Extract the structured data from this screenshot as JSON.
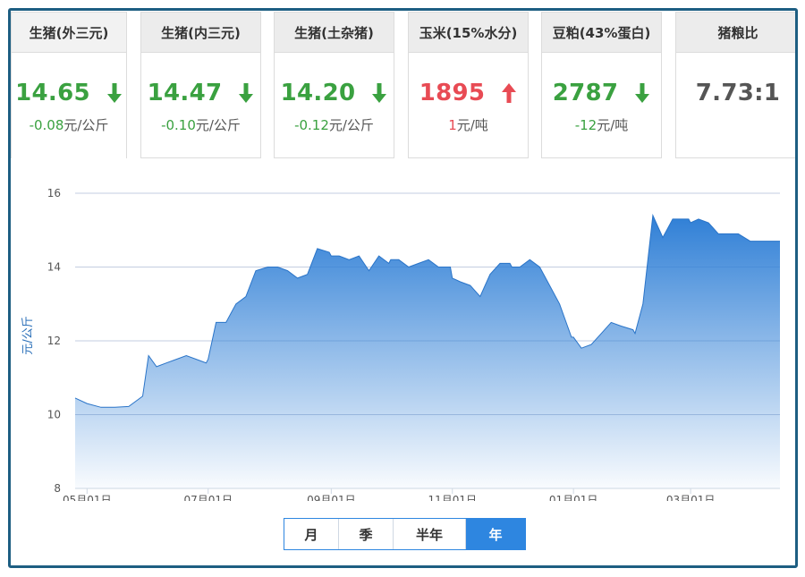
{
  "cards": [
    {
      "title": "生猪(外三元)",
      "price": "14.65",
      "change_num": "-0.08",
      "change_unit": "元/公斤",
      "direction": "down"
    },
    {
      "title": "生猪(内三元)",
      "price": "14.47",
      "change_num": "-0.10",
      "change_unit": "元/公斤",
      "direction": "down"
    },
    {
      "title": "生猪(土杂猪)",
      "price": "14.20",
      "change_num": "-0.12",
      "change_unit": "元/公斤",
      "direction": "down"
    },
    {
      "title": "玉米(15%水分)",
      "price": "1895",
      "change_num": "1",
      "change_unit": "元/吨",
      "direction": "up"
    },
    {
      "title": "豆粕(43%蛋白)",
      "price": "2787",
      "change_num": "-12",
      "change_unit": "元/吨",
      "direction": "down"
    },
    {
      "title": "猪粮比",
      "price": "7.73:1",
      "change_num": "",
      "change_unit": "",
      "direction": "none"
    }
  ],
  "colors": {
    "up": "#e84b54",
    "down": "#3aa140",
    "accent": "#2e86e0",
    "frame": "#1d5e82"
  },
  "range_buttons": [
    {
      "label": "月",
      "selected": false
    },
    {
      "label": "季",
      "selected": false
    },
    {
      "label": "半年",
      "selected": false
    },
    {
      "label": "年",
      "selected": true
    }
  ],
  "chart_data": {
    "type": "area",
    "ylabel": "元/公斤",
    "xlabel": "",
    "ylim": [
      8,
      16
    ],
    "yticks": [
      8,
      10,
      12,
      14,
      16
    ],
    "xticks": [
      "05月01日",
      "07月01日",
      "09月01日",
      "11月01日",
      "01月01日",
      "03月01日"
    ],
    "grid": true,
    "series": [
      {
        "x": [
          "04-25",
          "05-01",
          "05-08",
          "05-15",
          "05-22",
          "05-29",
          "06-01",
          "06-05",
          "06-10",
          "06-15",
          "06-20",
          "06-25",
          "06-30",
          "07-01",
          "07-05",
          "07-10",
          "07-15",
          "07-20",
          "07-25",
          "07-31",
          "08-05",
          "08-10",
          "08-15",
          "08-20",
          "08-25",
          "08-31",
          "09-01",
          "09-05",
          "09-10",
          "09-15",
          "09-20",
          "09-25",
          "09-30",
          "10-01",
          "10-05",
          "10-10",
          "10-15",
          "10-20",
          "10-25",
          "10-31",
          "11-01",
          "11-05",
          "11-10",
          "11-15",
          "11-20",
          "11-25",
          "11-30",
          "12-01",
          "12-05",
          "12-10",
          "12-15",
          "12-20",
          "12-25",
          "12-31",
          "01-01",
          "01-05",
          "01-10",
          "01-15",
          "01-20",
          "01-25",
          "01-31",
          "02-01",
          "02-05",
          "02-10",
          "02-15",
          "02-20",
          "02-25",
          "02-28",
          "03-01",
          "03-05",
          "03-10",
          "03-15",
          "03-20",
          "03-25",
          "03-31",
          "04-05",
          "04-10",
          "04-15"
        ],
        "y": [
          10.45,
          10.3,
          10.2,
          10.2,
          10.22,
          10.5,
          11.6,
          11.3,
          11.4,
          11.5,
          11.6,
          11.5,
          11.4,
          11.5,
          12.5,
          12.5,
          13.0,
          13.2,
          13.9,
          14.0,
          14.0,
          13.9,
          13.7,
          13.8,
          14.5,
          14.4,
          14.3,
          14.3,
          14.2,
          14.3,
          13.9,
          14.3,
          14.1,
          14.2,
          14.2,
          14.0,
          14.1,
          14.2,
          14.0,
          14.0,
          13.7,
          13.6,
          13.5,
          13.2,
          13.8,
          14.1,
          14.1,
          14.0,
          14.0,
          14.2,
          14.0,
          13.5,
          13.0,
          12.1,
          12.1,
          11.8,
          11.9,
          12.2,
          12.5,
          12.4,
          12.3,
          12.2,
          13.0,
          15.4,
          14.8,
          15.3,
          15.3,
          15.3,
          15.2,
          15.3,
          15.2,
          14.9,
          14.9,
          14.9,
          14.7,
          14.7,
          14.7,
          14.7
        ]
      }
    ]
  }
}
